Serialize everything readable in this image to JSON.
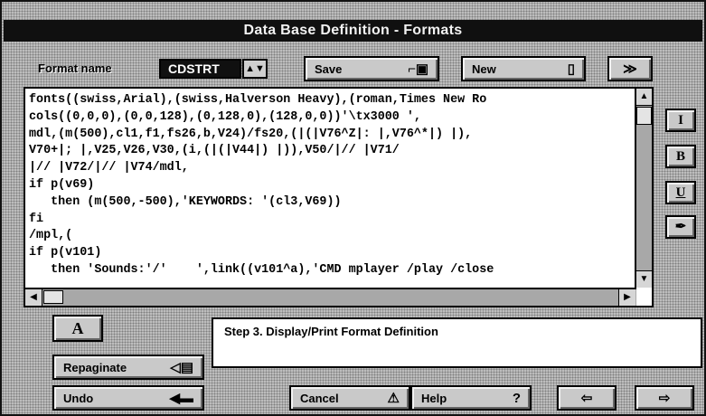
{
  "window": {
    "title": "Data Base Definition - Formats"
  },
  "toolbar": {
    "format_label": "Format name",
    "format_value": "CDSTRT",
    "save_label": "Save",
    "new_label": "New"
  },
  "editor": {
    "lines": [
      "fonts((swiss,Arial),(swiss,Halverson Heavy),(roman,Times New Ro",
      "cols((0,0,0),(0,0,128),(0,128,0),(128,0,0))'\\tx3000 ',",
      "mdl,(m(500),cl1,f1,fs26,b,V24)/fs20,(|(|V76^Z|: |,V76^*|) |),",
      "V70+|; |,V25,V26,V30,(i,(|(|V44|) |)),V50/|// |V71/",
      "|// |V72/|// |V74/mdl,",
      "if p(v69)",
      "   then (m(500,-500),'KEYWORDS: '(cl3,V69))",
      "fi",
      "/mpl,(",
      "if p(v101)",
      "   then 'Sounds:'/'    ',link((v101^a),'CMD mplayer /play /close"
    ]
  },
  "side_buttons": [
    "I",
    "B",
    "U",
    "✒"
  ],
  "status": {
    "text": "Step 3. Display/Print Format Definition"
  },
  "bottom": {
    "font_button": "A",
    "repaginate_label": "Repaginate",
    "undo_label": "Undo",
    "cancel_label": "Cancel",
    "help_label": "Help",
    "help_icon": "?"
  },
  "icons": {
    "save": "floppy-icon",
    "new": "document-icon",
    "forward": "double-arrow-icon",
    "prev": "left-arrow-icon",
    "next": "right-arrow-icon"
  }
}
